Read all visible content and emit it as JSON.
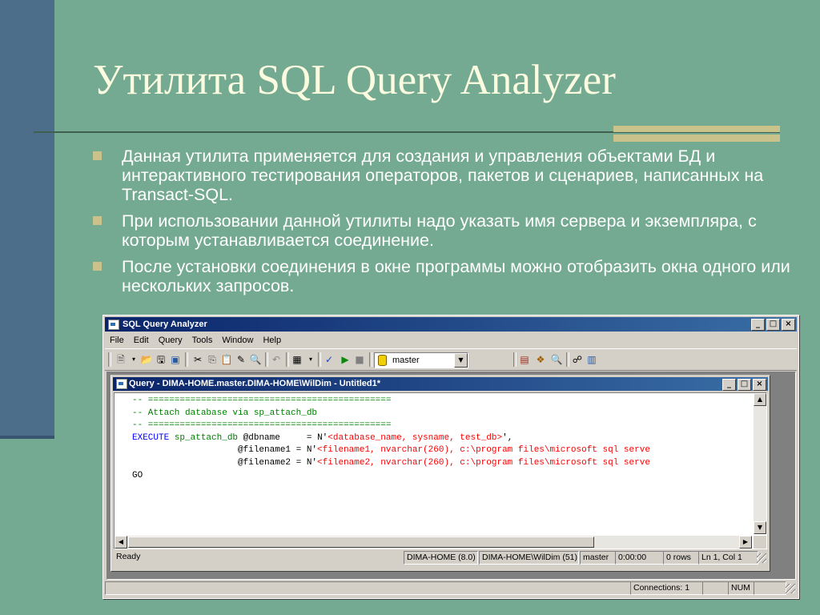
{
  "slide": {
    "title": "Утилита SQL Query Analyzer",
    "bullets": [
      "Данная утилита применяется для создания и управления объектами БД и интерактивного тестирования операторов, пакетов и сценариев, написанных на Transact-SQL.",
      "При использовании данной утилиты надо указать имя сервера и экземпляра, с которым устанавливается соединение.",
      "После установки соединения в окне программы можно отобразить окна одного или нескольких запросов."
    ]
  },
  "app": {
    "title": "SQL Query Analyzer",
    "window_buttons": [
      "_",
      "□",
      "×"
    ],
    "menu": [
      "File",
      "Edit",
      "Query",
      "Tools",
      "Window",
      "Help"
    ],
    "database_select": "master",
    "toolbar_icons": [
      "new-query-icon",
      "open-icon",
      "save-icon",
      "insert-template-icon",
      "cut-icon",
      "copy-icon",
      "paste-icon",
      "clear-icon",
      "find-icon",
      "undo-icon",
      "results-mode-icon",
      "parse-icon",
      "execute-icon",
      "stop-icon",
      "object-browser-icon",
      "object-search-icon",
      "show-execution-plan-icon",
      "current-connection-icon",
      "show-results-pane-icon"
    ]
  },
  "query_window": {
    "title": "Query - DIMA-HOME.master.DIMA-HOME\\WilDim - Untitled1*",
    "code_lines": [
      [
        {
          "t": "-- ==============================================",
          "c": "com"
        }
      ],
      [
        {
          "t": "-- Attach database via sp_attach_db",
          "c": "com"
        }
      ],
      [
        {
          "t": "-- ==============================================",
          "c": "com"
        }
      ],
      [
        {
          "t": "EXECUTE",
          "c": "kw"
        },
        {
          "t": " sp_attach_db",
          "c": "com"
        },
        {
          "t": " @dbname     = N'",
          "c": ""
        },
        {
          "t": "<database_name, sysname, test_db>",
          "c": "str"
        },
        {
          "t": "',",
          "c": ""
        }
      ],
      [
        {
          "t": "                    @filename1 = N'",
          "c": ""
        },
        {
          "t": "<filename1, nvarchar(260), c:\\program files\\microsoft sql serve",
          "c": "str"
        }
      ],
      [
        {
          "t": "                    @filename2 = N'",
          "c": ""
        },
        {
          "t": "<filename2, nvarchar(260), c:\\program files\\microsoft sql serve",
          "c": "str"
        }
      ],
      [
        {
          "t": "GO",
          "c": ""
        }
      ]
    ],
    "status": {
      "ready": "Ready",
      "server": "DIMA-HOME (8.0)",
      "user": "DIMA-HOME\\WilDim (51)",
      "database": "master",
      "time": "0:00:00",
      "rows": "0 rows",
      "position": "Ln 1, Col 1"
    }
  },
  "app_status": {
    "connections": "Connections: 1",
    "num": "NUM"
  }
}
